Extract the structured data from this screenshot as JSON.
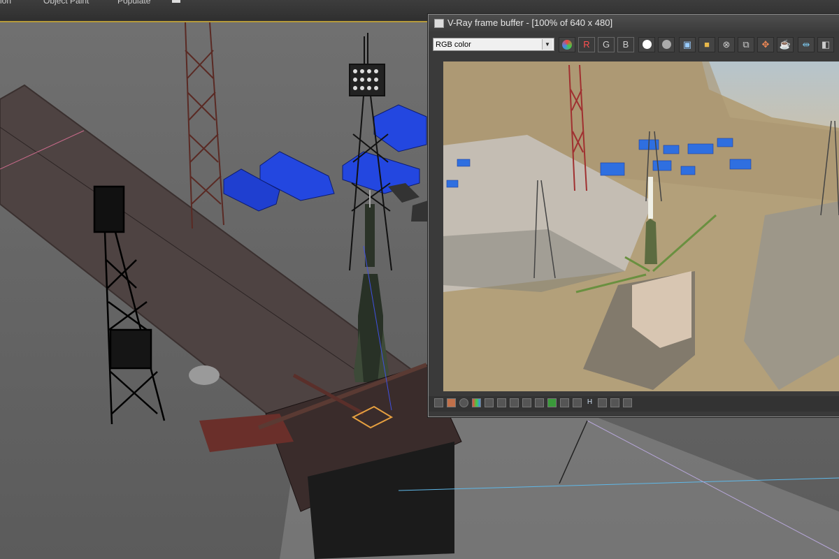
{
  "ribbon": {
    "tabs": [
      "ion",
      "Object Paint",
      "Populate"
    ]
  },
  "viewport": {
    "name": "Perspective viewport",
    "colors": {
      "background": "#666666",
      "pad": "#4e4342",
      "buildings": "#1f3fd0",
      "selection": "#e6a040"
    }
  },
  "frame_buffer": {
    "title": "V-Ray frame buffer - [100% of 640 x 480]",
    "channel": "RGB color",
    "channel_buttons": {
      "red": "R",
      "green": "G",
      "blue": "B"
    },
    "toolbar_icons": [
      "color-correction-icon",
      "white-dot-icon",
      "gray-dot-icon",
      "save-icon",
      "open-folder-icon",
      "clear-icon",
      "track-mouse-icon",
      "region-render-icon",
      "teapot-render-icon",
      "lut-icon",
      "compare-icon"
    ],
    "bottom_icons": [
      "display-correction-icon",
      "history-icon",
      "info-icon",
      "colors-icon",
      "stats-icon",
      "list-icon",
      "histogram-icon",
      "levels-icon",
      "aspect-icon",
      "lens-icon",
      "camera-icon",
      "sg-icon",
      "h-icon",
      "pixel-aspect-icon",
      "compare-ab-icon",
      "lut-toggle-icon"
    ],
    "bottom_labels": {
      "h": "H"
    }
  }
}
